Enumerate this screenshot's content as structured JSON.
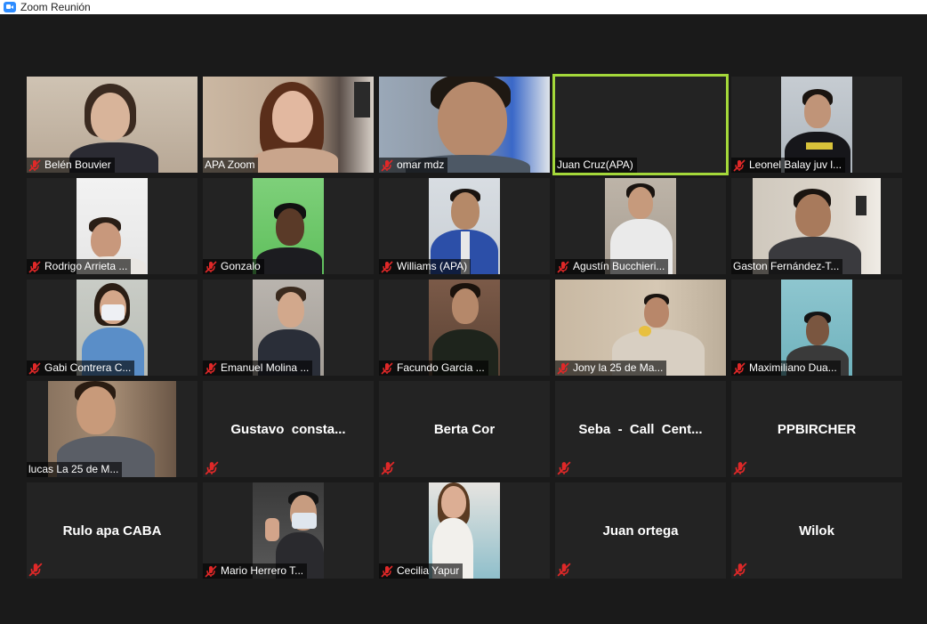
{
  "window": {
    "title": "Zoom Reunión",
    "app_icon": "zoom-camera-icon"
  },
  "colors": {
    "active_speaker_border": "#a4d83a",
    "muted_icon": "#e02828",
    "tile_background": "#232323",
    "stage_background": "#1a1a1a"
  },
  "participants": [
    {
      "name": "Belén Bouvier",
      "muted": true,
      "video": true
    },
    {
      "name": "APA Zoom",
      "muted": false,
      "video": true
    },
    {
      "name": "omar mdz",
      "muted": true,
      "video": true
    },
    {
      "name": "Juan Cruz(APA)",
      "muted": false,
      "video": true,
      "active_speaker": true
    },
    {
      "name": "Leonel Balay juv l...",
      "muted": true,
      "video": true
    },
    {
      "name": "Rodrigo Arrieta ...",
      "muted": true,
      "video": true
    },
    {
      "name": "Gonzalo",
      "muted": true,
      "video": true
    },
    {
      "name": "Williams (APA)",
      "muted": true,
      "video": true
    },
    {
      "name": "Agustín Bucchieri...",
      "muted": true,
      "video": true
    },
    {
      "name": "Gaston Fernández-T...",
      "muted": false,
      "video": true
    },
    {
      "name": "Gabi Contrera C...",
      "muted": true,
      "video": true
    },
    {
      "name": "Emanuel Molina ...",
      "muted": true,
      "video": true
    },
    {
      "name": "Facundo Garcia ...",
      "muted": true,
      "video": true
    },
    {
      "name": "Jony la 25 de Ma...",
      "muted": true,
      "video": true
    },
    {
      "name": "Maximiliano Dua...",
      "muted": true,
      "video": true
    },
    {
      "name": "lucas La 25 de M...",
      "muted": false,
      "video": true
    },
    {
      "name": "Gustavo  consta...",
      "muted": true,
      "video": false
    },
    {
      "name": "Berta Cor",
      "muted": true,
      "video": false
    },
    {
      "name": "Seba  -  Call  Cent...",
      "muted": true,
      "video": false
    },
    {
      "name": "PPBIRCHER",
      "muted": true,
      "video": false
    },
    {
      "name": "Rulo apa CABA",
      "muted": true,
      "video": false
    },
    {
      "name": "Mario Herrero T...",
      "muted": true,
      "video": true
    },
    {
      "name": "Cecilia Yapur",
      "muted": true,
      "video": true
    },
    {
      "name": "Juan ortega",
      "muted": true,
      "video": false
    },
    {
      "name": "Wilok",
      "muted": true,
      "video": false
    }
  ]
}
